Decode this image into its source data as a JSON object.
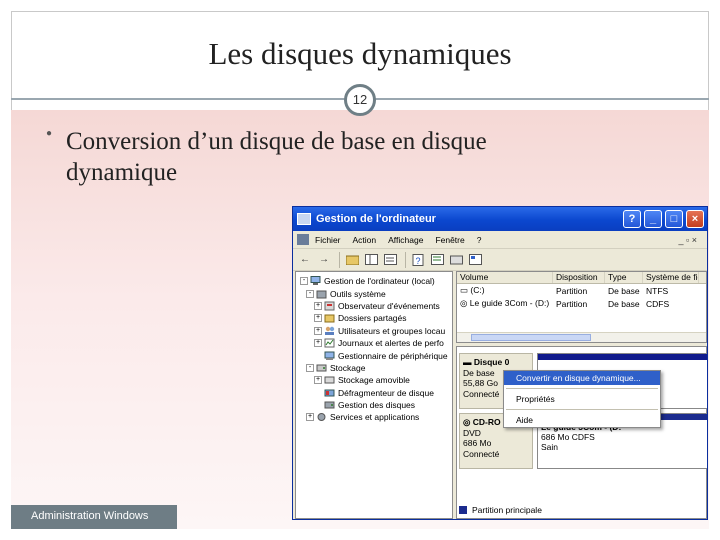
{
  "slide": {
    "title": "Les disques dynamiques",
    "page_number": "12",
    "bullet": "Conversion d’un disque de base en disque dynamique",
    "footer": "Administration Windows"
  },
  "window": {
    "title": "Gestion de l'ordinateur",
    "controls": [
      "?",
      "_",
      "□",
      "×"
    ],
    "menu": [
      "Fichier",
      "Action",
      "Affichage",
      "Fenêtre",
      "?"
    ],
    "menu_right": "_ ▫ ×",
    "tree": [
      {
        "label": "Gestion de l'ordinateur (local)",
        "indent": 0,
        "expander": "-",
        "icon": "computer-icon"
      },
      {
        "label": "Outils système",
        "indent": 1,
        "expander": "-",
        "icon": "tools-icon"
      },
      {
        "label": "Observateur d'événements",
        "indent": 2,
        "expander": "+",
        "icon": "event-viewer-icon"
      },
      {
        "label": "Dossiers partagés",
        "indent": 2,
        "expander": "+",
        "icon": "shared-folder-icon"
      },
      {
        "label": "Utilisateurs et groupes locau",
        "indent": 2,
        "expander": "+",
        "icon": "users-icon"
      },
      {
        "label": "Journaux et alertes de perfo",
        "indent": 2,
        "expander": "+",
        "icon": "performance-icon"
      },
      {
        "label": "Gestionnaire de périphérique",
        "indent": 2,
        "expander": "",
        "icon": "device-manager-icon"
      },
      {
        "label": "Stockage",
        "indent": 1,
        "expander": "-",
        "icon": "storage-icon"
      },
      {
        "label": "Stockage amovible",
        "indent": 2,
        "expander": "+",
        "icon": "removable-storage-icon"
      },
      {
        "label": "Défragmenteur de disque",
        "indent": 2,
        "expander": "",
        "icon": "defrag-icon"
      },
      {
        "label": "Gestion des disques",
        "indent": 2,
        "expander": "",
        "icon": "disk-management-icon"
      },
      {
        "label": "Services et applications",
        "indent": 1,
        "expander": "+",
        "icon": "services-icon"
      }
    ],
    "volume_list": {
      "headers": [
        "Volume",
        "Disposition",
        "Type",
        "Système de fichi"
      ],
      "rows": [
        [
          "(C:)",
          "Partition",
          "De base",
          "NTFS"
        ],
        [
          "Le guide 3Com - (D:)",
          "Partition",
          "De base",
          "CDFS"
        ]
      ]
    },
    "disks": [
      {
        "name": "Disque 0",
        "lines": [
          "De base",
          "55,88 Go",
          "Connecté"
        ],
        "partition_lines": []
      },
      {
        "name": "CD-RO",
        "lines": [
          "DVD",
          "686 Mo",
          "Connecté"
        ],
        "partition_lines": [
          "Le guide 3Com - (D:",
          "686 Mo CDFS",
          "Sain"
        ]
      }
    ],
    "legend": "Partition principale",
    "context_menu": [
      "Convertir en disque dynamique...",
      "Propriétés",
      "Aide"
    ]
  },
  "colors": {
    "titlebar": "#0b47cf",
    "primary_partition": "#1b2b8e",
    "highlight": "#2f60c9",
    "footer": "#6e7d85"
  }
}
